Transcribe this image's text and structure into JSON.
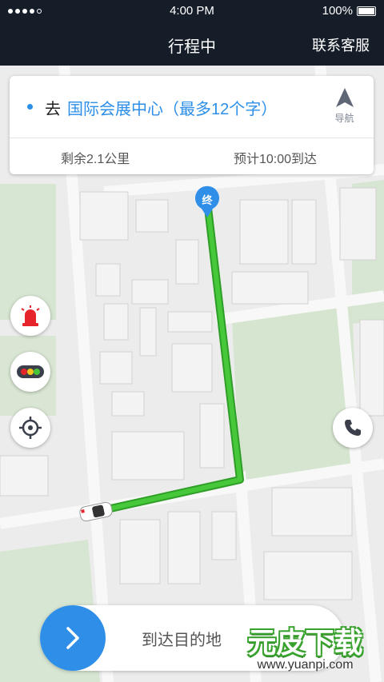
{
  "status_bar": {
    "time": "4:00 PM",
    "battery": "100%"
  },
  "nav": {
    "title": "行程中",
    "service": "联系客服"
  },
  "trip": {
    "prefix": "去",
    "destination": "国际会展中心（最多12个字）",
    "nav_label": "导航",
    "remaining": "剩余2.1公里",
    "eta": "预计10:00到达"
  },
  "map": {
    "end_marker": "终"
  },
  "bottom": {
    "arrive_text": "到达目的地"
  },
  "watermark": {
    "title": "元皮下载",
    "url": "www.yuanpi.com"
  },
  "colors": {
    "route": "#3bbf2f",
    "accent": "#2b8ee8",
    "header": "#151d29",
    "alarm": "#e6242b"
  },
  "icons": [
    "location-arrow-icon",
    "alarm-light-icon",
    "traffic-light-icon",
    "locate-icon",
    "phone-icon",
    "chevron-right-icon"
  ]
}
